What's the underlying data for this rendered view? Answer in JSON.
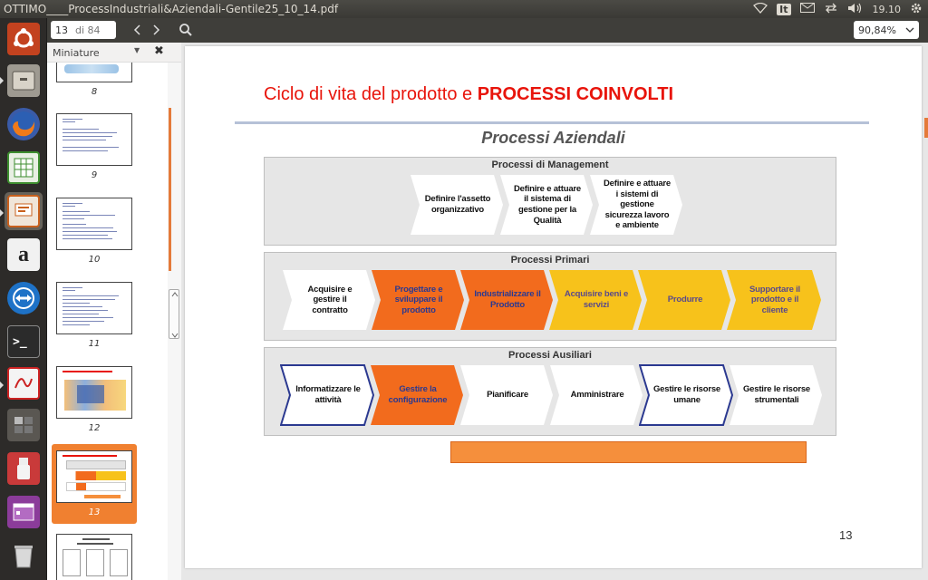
{
  "window": {
    "title": "OTTIMO____ProcessIndustriali&Aziendali-Gentile25_10_14.pdf"
  },
  "tray": {
    "time": "19.10",
    "it_label": "It"
  },
  "toolbar": {
    "page_current": "13",
    "page_total": "di 84",
    "zoom": "90,84%"
  },
  "sidebar": {
    "title": "Miniature",
    "thumbnails": [
      {
        "num": "8"
      },
      {
        "num": "9"
      },
      {
        "num": "10"
      },
      {
        "num": "11"
      },
      {
        "num": "12"
      },
      {
        "num": "13",
        "selected": true
      },
      {
        "num": ""
      }
    ]
  },
  "slide": {
    "title_plain": "Ciclo di vita del prodotto e ",
    "title_bold": "PROCESSI COINVOLTI",
    "subtitle": "Processi Aziendali",
    "page_number": "13",
    "groups": [
      {
        "title": "Processi di Management",
        "steps": [
          {
            "label": "Definire l'assetto organizzativo",
            "style": "white"
          },
          {
            "label": "Definire e attuare il sistema di gestione per la Qualità",
            "style": "white"
          },
          {
            "label": "Definire e attuare i sistemi di gestione sicurezza lavoro e ambiente",
            "style": "white"
          }
        ]
      },
      {
        "title": "Processi Primari",
        "steps": [
          {
            "label": "Acquisire e gestire il contratto",
            "style": "white"
          },
          {
            "label": "Progettare e sviluppare il prodotto",
            "style": "orange"
          },
          {
            "label": "Industrializzare il Prodotto",
            "style": "orange"
          },
          {
            "label": "Acquisire beni e servizi",
            "style": "yellow"
          },
          {
            "label": "Produrre",
            "style": "yellow"
          },
          {
            "label": "Supportare il prodotto e il cliente",
            "style": "yellow"
          }
        ]
      },
      {
        "title": "Processi Ausiliari",
        "steps": [
          {
            "label": "Informatizzare le attività",
            "style": "outlined"
          },
          {
            "label": "Gestire la configurazione",
            "style": "orange"
          },
          {
            "label": "Pianificare",
            "style": "white"
          },
          {
            "label": "Amministrare",
            "style": "white"
          },
          {
            "label": "Gestire le risorse umane",
            "style": "outlined"
          },
          {
            "label": "Gestire le risorse strumentali",
            "style": "white"
          }
        ]
      }
    ]
  },
  "colors": {
    "orange": "#f26b1d",
    "yellow": "#f7c21b",
    "outline_blue": "#2b3990",
    "title_red": "#e8140b",
    "selection": "#f08030"
  }
}
